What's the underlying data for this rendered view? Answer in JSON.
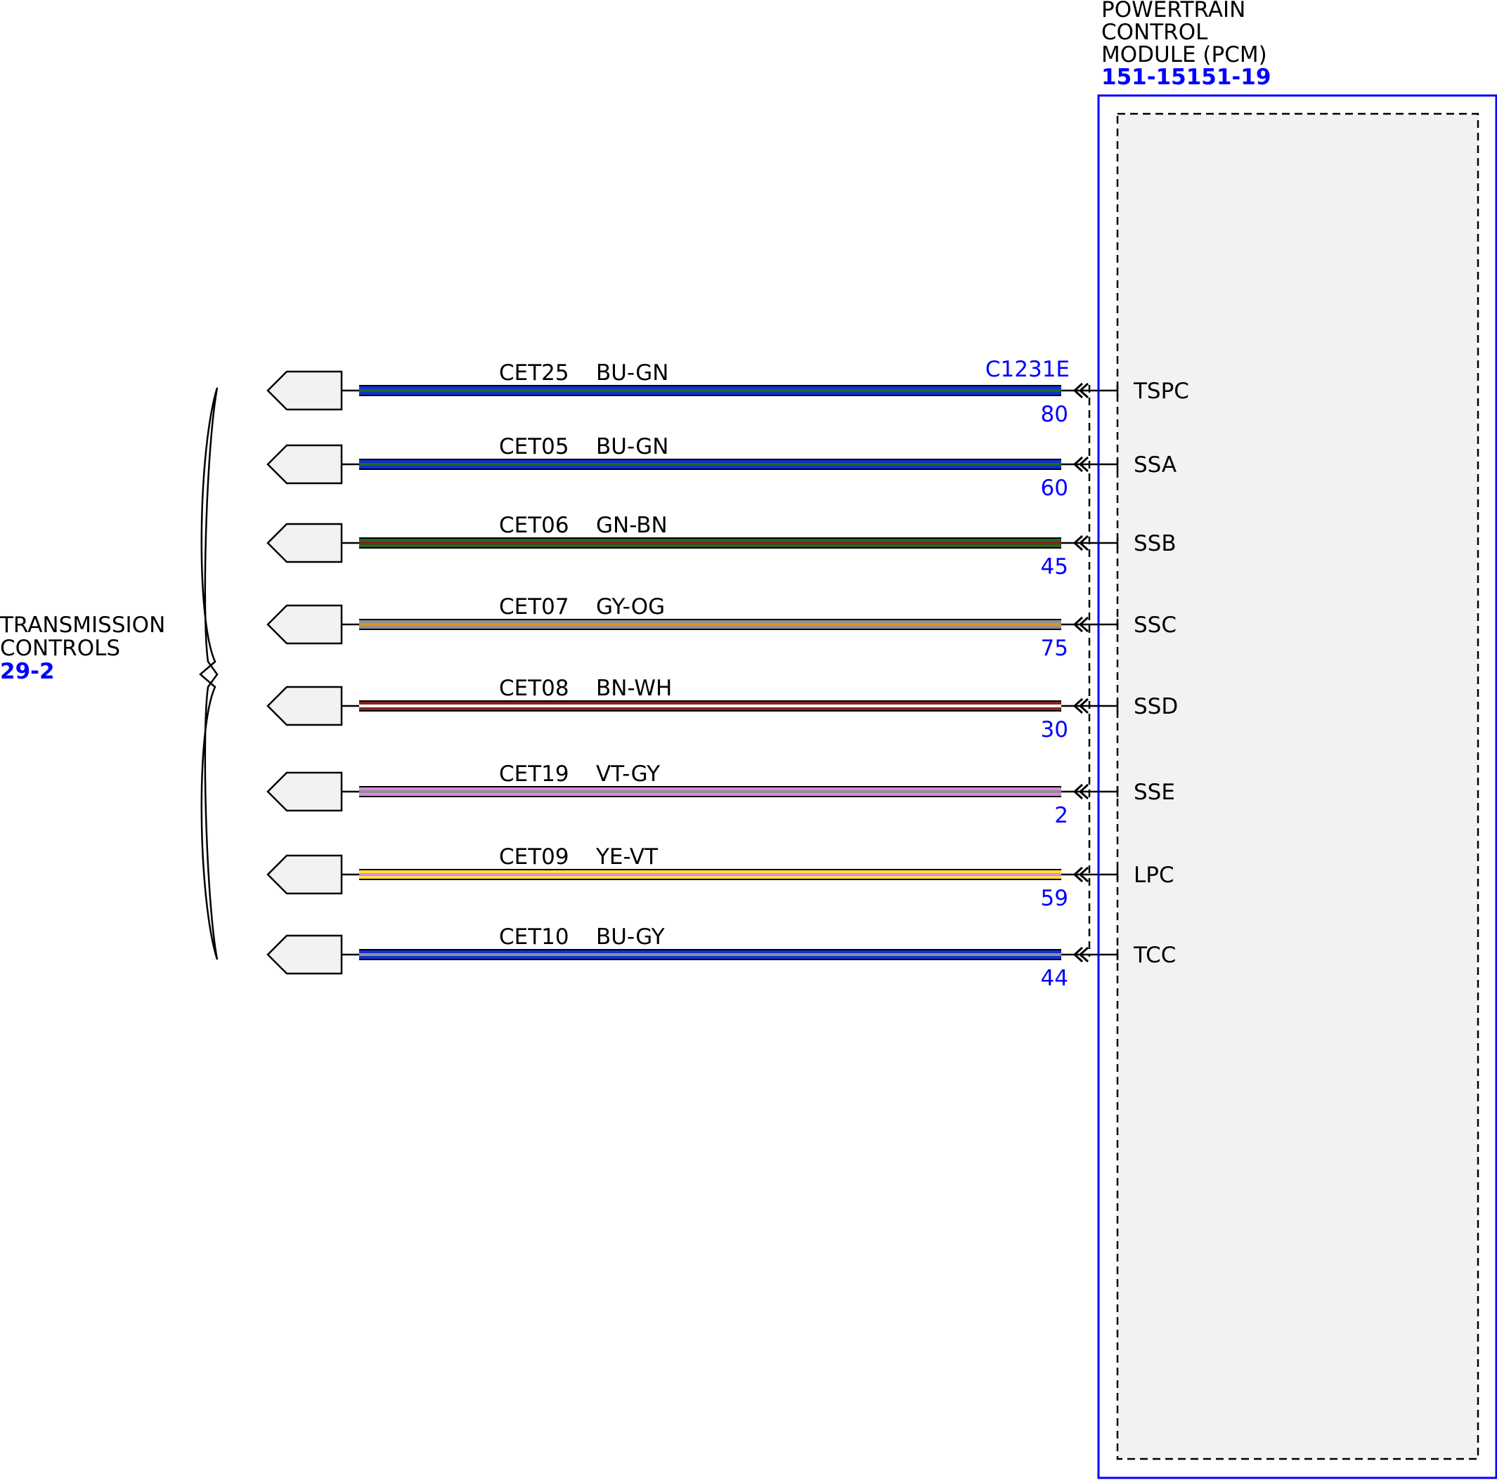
{
  "module": {
    "title_lines": [
      "POWERTRAIN",
      "CONTROL",
      "MODULE (PCM)"
    ],
    "ref": "151-15151-19"
  },
  "group": {
    "title_lines": [
      "TRANSMISSION",
      "CONTROLS"
    ],
    "ref": "29-2"
  },
  "connector": "C1231E",
  "colors": {
    "link_blue": "#0000ff",
    "module_fill": "#f2f2f2",
    "connector_fill": "#f2f2f2",
    "BU": "#1030d0",
    "GN": "#1e6a1e",
    "BN": "#8a2020",
    "GY": "#909090",
    "OG": "#e0902a",
    "WH": "#ffffff",
    "VT": "#e088e0",
    "YE": "#ffe040"
  },
  "wires": [
    {
      "circuit": "CET25",
      "color_code": "BU-GN",
      "pin": "80",
      "signal": "TSPC",
      "base": "BU",
      "stripe": "GN"
    },
    {
      "circuit": "CET05",
      "color_code": "BU-GN",
      "pin": "60",
      "signal": "SSA",
      "base": "BU",
      "stripe": "GN"
    },
    {
      "circuit": "CET06",
      "color_code": "GN-BN",
      "pin": "45",
      "signal": "SSB",
      "base": "GN",
      "stripe": "BN"
    },
    {
      "circuit": "CET07",
      "color_code": "GY-OG",
      "pin": "75",
      "signal": "SSC",
      "base": "GY",
      "stripe": "OG"
    },
    {
      "circuit": "CET08",
      "color_code": "BN-WH",
      "pin": "30",
      "signal": "SSD",
      "base": "BN",
      "stripe": "WH"
    },
    {
      "circuit": "CET19",
      "color_code": "VT-GY",
      "pin": "2",
      "signal": "SSE",
      "base": "VT",
      "stripe": "GY"
    },
    {
      "circuit": "CET09",
      "color_code": "YE-VT",
      "pin": "59",
      "signal": "LPC",
      "base": "YE",
      "stripe": "VT"
    },
    {
      "circuit": "CET10",
      "color_code": "BU-GY",
      "pin": "44",
      "signal": "TCC",
      "base": "BU",
      "stripe": "GY"
    }
  ]
}
